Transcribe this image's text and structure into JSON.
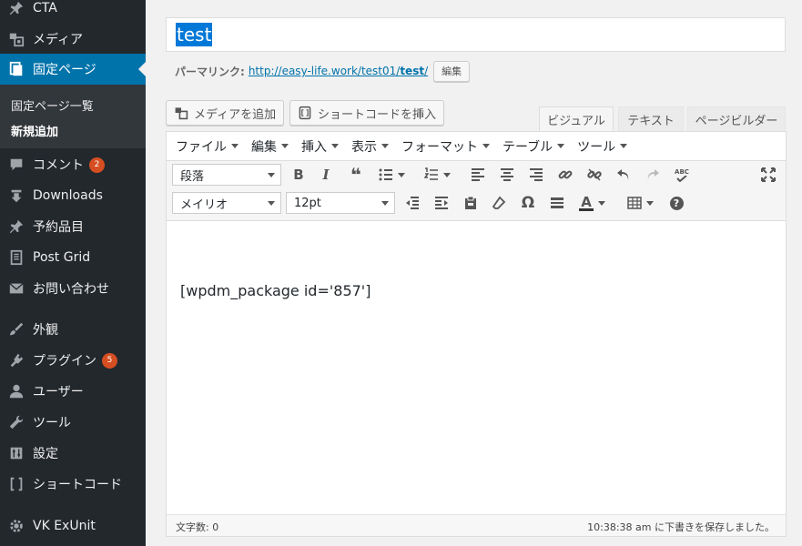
{
  "sidebar": {
    "items": [
      {
        "label": "CTA",
        "icon": "pin-icon"
      },
      {
        "label": "メディア",
        "icon": "media-icon"
      },
      {
        "label": "固定ページ",
        "icon": "pages-icon"
      },
      {
        "label": "コメント",
        "icon": "comment-icon",
        "badge": "2"
      },
      {
        "label": "Downloads",
        "icon": "download-icon"
      },
      {
        "label": "予約品目",
        "icon": "pin-icon"
      },
      {
        "label": "Post Grid",
        "icon": "document-icon"
      },
      {
        "label": "お問い合わせ",
        "icon": "mail-icon"
      },
      {
        "label": "外観",
        "icon": "brush-icon"
      },
      {
        "label": "プラグイン",
        "icon": "plugin-icon",
        "badge": "5"
      },
      {
        "label": "ユーザー",
        "icon": "user-icon"
      },
      {
        "label": "ツール",
        "icon": "wrench-icon"
      },
      {
        "label": "設定",
        "icon": "settings-icon"
      },
      {
        "label": "ショートコード",
        "icon": "brackets-icon"
      },
      {
        "label": "VK ExUnit",
        "icon": "gear-icon"
      }
    ],
    "submenu": [
      "固定ページ一覧",
      "新規追加"
    ]
  },
  "editor": {
    "title": "test",
    "permalink_label": "パーマリンク:",
    "permalink_url_prefix": "http://easy-life.work/test01/",
    "permalink_slug": "test",
    "permalink_url_suffix": "/",
    "edit_button": "編集",
    "add_media": "メディアを追加",
    "insert_shortcode": "ショートコードを挿入",
    "tabs": [
      "ビジュアル",
      "テキスト",
      "ページビルダー"
    ],
    "menus": [
      "ファイル",
      "編集",
      "挿入",
      "表示",
      "フォーマット",
      "テーブル",
      "ツール"
    ],
    "format_select": "段落",
    "font_select": "メイリオ",
    "size_select": "12pt",
    "bold_glyph": "B",
    "italic_glyph": "I",
    "quote_glyph": "❝",
    "omega_glyph": "Ω",
    "help_glyph": "?",
    "abc_glyph": "ABC",
    "text_color_glyph": "A",
    "content": "[wpdm_package id='857']",
    "word_count": "文字数: 0",
    "save_status": "10:38:38 am に下書きを保存しました。"
  },
  "colors": {
    "sidebar_bg": "#23282d",
    "accent": "#0073aa",
    "badge": "#d54e21"
  }
}
